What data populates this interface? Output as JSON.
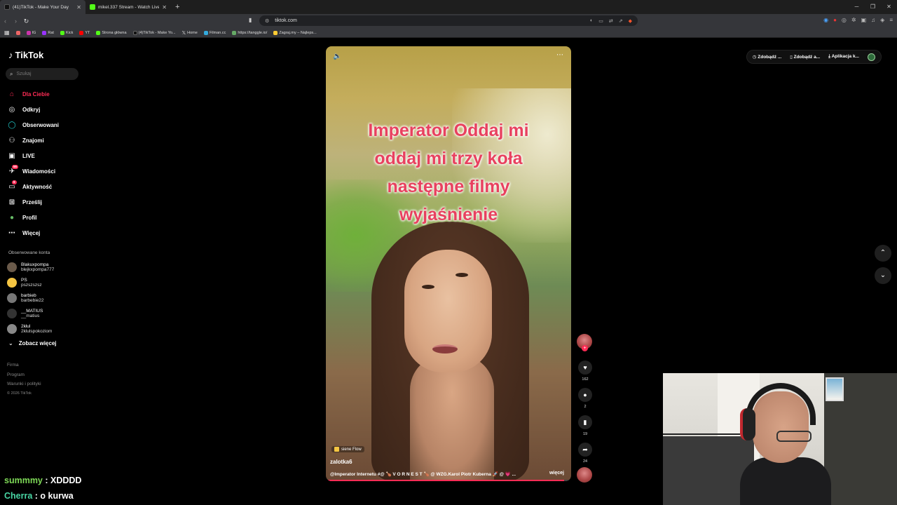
{
  "browser": {
    "tabs": [
      {
        "title": "(41)TikTok - Make Your Day",
        "active": true
      },
      {
        "title": "mikel.337 Stream - Watch Live on Ki",
        "active": false
      }
    ],
    "url": "tiktok.com",
    "bookmarks": [
      "IG",
      "Rat",
      "Kick",
      "YT",
      "Strona główna",
      "(4)TikTok - Make Yo...",
      "Home",
      "Filman.cc",
      "https://tanggle.io/",
      "Zagraj.my – Najleps..."
    ]
  },
  "sidebar": {
    "logo": "TikTok",
    "search_placeholder": "Szukaj",
    "nav": [
      {
        "label": "Dla Ciebie",
        "icon": "home-icon"
      },
      {
        "label": "Odkryj",
        "icon": "compass-icon"
      },
      {
        "label": "Obserwowani",
        "icon": "following-icon"
      },
      {
        "label": "Znajomi",
        "icon": "friends-icon"
      },
      {
        "label": "LIVE",
        "icon": "live-icon"
      },
      {
        "label": "Wiadomości",
        "icon": "messages-icon",
        "badge": "55"
      },
      {
        "label": "Aktywność",
        "icon": "activity-icon",
        "badge": "9"
      },
      {
        "label": "Prześlij",
        "icon": "upload-icon"
      },
      {
        "label": "Profil",
        "icon": "profile-icon"
      },
      {
        "label": "Więcej",
        "icon": "more-icon"
      }
    ],
    "followed_header": "Obserwowane konta",
    "accounts": [
      {
        "name": "Blakuxpompa",
        "user": "blejkxpompa777"
      },
      {
        "name": "PS",
        "user": "pszszszsz"
      },
      {
        "name": "barbieb",
        "user": "barbebie22"
      },
      {
        "name": "__MATIUS",
        "user": "__matius"
      },
      {
        "name": "2kłul",
        "user": "2klulspokoziom"
      }
    ],
    "see_more": "Zobacz więcej",
    "footer": [
      "Firma",
      "Program",
      "Warunki i polityki",
      "© 2026 TikTok"
    ]
  },
  "topbar": {
    "items": [
      "Zdobądź ...",
      "Zdobądź a...",
      "Aplikacja k..."
    ]
  },
  "video": {
    "overlay_lines": [
      "Imperator Oddaj mi",
      "oddaj mi trzy koła",
      "następne filmy",
      "wyjaśnienie"
    ],
    "music_tag": "siene Flow",
    "author": "zalotka6",
    "description": "@Imperator Internetu #@ 🍗 V O R N E S T 🍗 @ WZG.Karol Piotr Kuberna 🚀 @ 💗 ...",
    "more_label": "więcej",
    "progress": 0.97
  },
  "actions": {
    "likes": "162",
    "comments": "2",
    "saves": "19",
    "shares": "24"
  },
  "chat": [
    {
      "user": "summmy",
      "message": "XDDDD"
    },
    {
      "user": "Cherra",
      "message": "o kurwa"
    }
  ],
  "colors": {
    "accent": "#fe2c55",
    "overlay_text": "#e8415f"
  }
}
